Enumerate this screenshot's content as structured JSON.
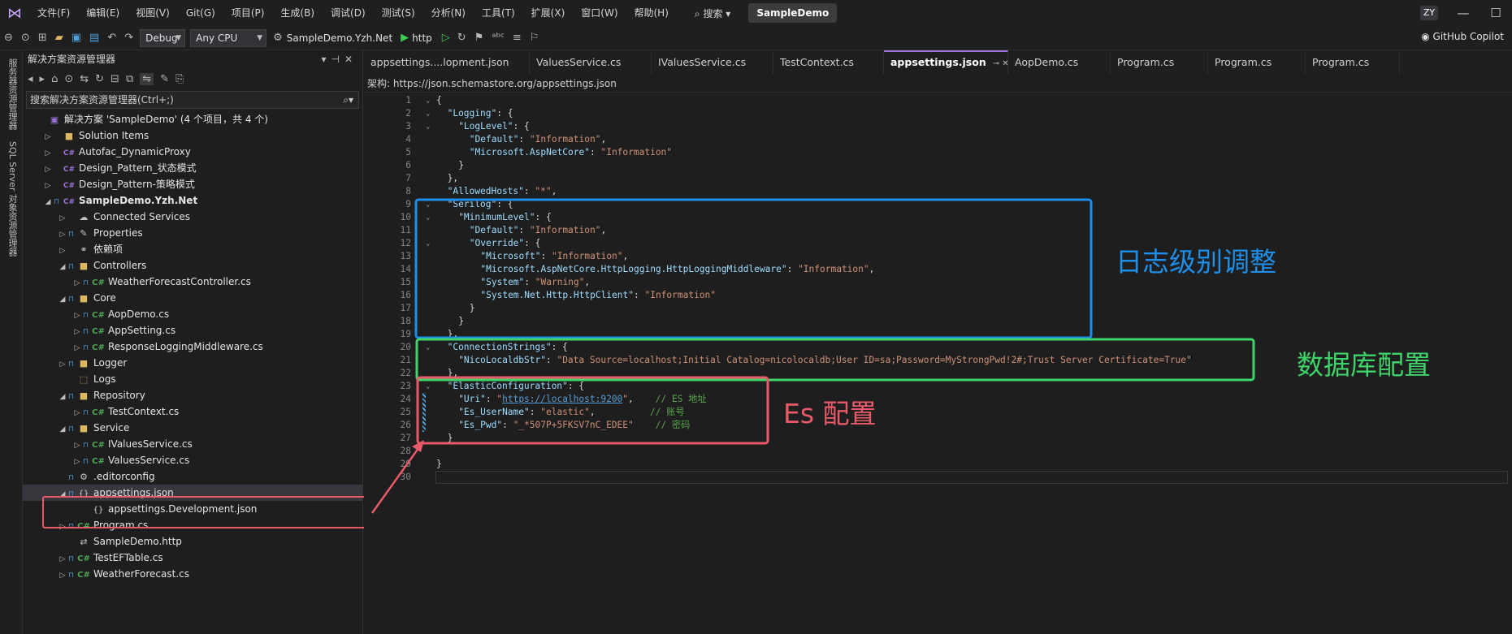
{
  "menubar": {
    "items": [
      "文件(F)",
      "编辑(E)",
      "视图(V)",
      "Git(G)",
      "项目(P)",
      "生成(B)",
      "调试(D)",
      "测试(S)",
      "分析(N)",
      "工具(T)",
      "扩展(X)",
      "窗口(W)",
      "帮助(H)"
    ],
    "search_label": "搜索",
    "project_name": "SampleDemo",
    "user_initials": "ZY"
  },
  "toolbar": {
    "config": "Debug",
    "platform": "Any CPU",
    "startup_project": "SampleDemo.Yzh.Net",
    "run_profile": "http",
    "copilot_label": "GitHub Copilot"
  },
  "left_strip": {
    "server_explorer": "服务器资源管理器",
    "sql_explorer": "SQL Server 对象资源管理器"
  },
  "solution_explorer": {
    "title": "解决方案资源管理器",
    "search_placeholder": "搜索解决方案资源管理器(Ctrl+;)",
    "tree": [
      {
        "label": "解决方案 'SampleDemo' (4 个项目，共 4 个)",
        "indent": 0,
        "icon": "solution-icon",
        "glyph": "▣",
        "expander": "",
        "lock": false
      },
      {
        "label": "Solution Items",
        "indent": 1,
        "icon": "folder-icon",
        "glyph": "■",
        "expander": "▷",
        "lock": false
      },
      {
        "label": "Autofac_DynamicProxy",
        "indent": 1,
        "icon": "csproj-icon",
        "glyph": "C#",
        "expander": "▷",
        "lock": false
      },
      {
        "label": "Design_Pattern_状态模式",
        "indent": 1,
        "icon": "csproj-icon",
        "glyph": "C#",
        "expander": "▷",
        "lock": false
      },
      {
        "label": "Design_Pattern-策略模式",
        "indent": 1,
        "icon": "csproj-icon",
        "glyph": "C#",
        "expander": "▷",
        "lock": false
      },
      {
        "label": "SampleDemo.Yzh.Net",
        "indent": 1,
        "icon": "csproj-icon",
        "glyph": "C#",
        "expander": "◢",
        "lock": true,
        "bold": true
      },
      {
        "label": "Connected Services",
        "indent": 2,
        "icon": "connected-services-icon",
        "glyph": "☁",
        "expander": "▷",
        "lock": false
      },
      {
        "label": "Properties",
        "indent": 2,
        "icon": "properties-icon",
        "glyph": "✎",
        "expander": "▷",
        "lock": true
      },
      {
        "label": "依赖项",
        "indent": 2,
        "icon": "dependencies-icon",
        "glyph": "⚭",
        "expander": "▷",
        "lock": false
      },
      {
        "label": "Controllers",
        "indent": 2,
        "icon": "folder-icon",
        "glyph": "■",
        "expander": "◢",
        "lock": true
      },
      {
        "label": "WeatherForecastController.cs",
        "indent": 3,
        "icon": "cs-file-icon",
        "glyph": "C#",
        "expander": "▷",
        "lock": true
      },
      {
        "label": "Core",
        "indent": 2,
        "icon": "folder-icon",
        "glyph": "■",
        "expander": "◢",
        "lock": true
      },
      {
        "label": "AopDemo.cs",
        "indent": 3,
        "icon": "cs-file-icon",
        "glyph": "C#",
        "expander": "▷",
        "lock": true
      },
      {
        "label": "AppSetting.cs",
        "indent": 3,
        "icon": "cs-file-icon",
        "glyph": "C#",
        "expander": "▷",
        "lock": true
      },
      {
        "label": "ResponseLoggingMiddleware.cs",
        "indent": 3,
        "icon": "cs-file-icon",
        "glyph": "C#",
        "expander": "▷",
        "lock": true
      },
      {
        "label": "Logger",
        "indent": 2,
        "icon": "folder-icon",
        "glyph": "■",
        "expander": "▷",
        "lock": true
      },
      {
        "label": "Logs",
        "indent": 2,
        "icon": "folder-icon",
        "glyph": "⬚",
        "expander": "",
        "lock": false
      },
      {
        "label": "Repository",
        "indent": 2,
        "icon": "folder-icon",
        "glyph": "■",
        "expander": "◢",
        "lock": true
      },
      {
        "label": "TestContext.cs",
        "indent": 3,
        "icon": "cs-file-icon",
        "glyph": "C#",
        "expander": "▷",
        "lock": true
      },
      {
        "label": "Service",
        "indent": 2,
        "icon": "folder-icon",
        "glyph": "■",
        "expander": "◢",
        "lock": true
      },
      {
        "label": "IValuesService.cs",
        "indent": 3,
        "icon": "cs-file-icon",
        "glyph": "C#",
        "expander": "▷",
        "lock": true
      },
      {
        "label": "ValuesService.cs",
        "indent": 3,
        "icon": "cs-file-icon",
        "glyph": "C#",
        "expander": "▷",
        "lock": true
      },
      {
        "label": ".editorconfig",
        "indent": 2,
        "icon": "config-file-icon",
        "glyph": "⚙",
        "expander": "",
        "lock": true
      },
      {
        "label": "appsettings.json",
        "indent": 2,
        "icon": "json-file-icon",
        "glyph": "{}",
        "expander": "◢",
        "lock": true,
        "selected": true
      },
      {
        "label": "appsettings.Development.json",
        "indent": 3,
        "icon": "json-file-icon",
        "glyph": "{}",
        "expander": "",
        "lock": false
      },
      {
        "label": "Program.cs",
        "indent": 2,
        "icon": "cs-file-icon",
        "glyph": "C#",
        "expander": "▷",
        "lock": true
      },
      {
        "label": "SampleDemo.http",
        "indent": 2,
        "icon": "http-file-icon",
        "glyph": "⇄",
        "expander": "",
        "lock": false
      },
      {
        "label": "TestEFTable.cs",
        "indent": 2,
        "icon": "cs-file-icon",
        "glyph": "C#",
        "expander": "▷",
        "lock": true
      },
      {
        "label": "WeatherForecast.cs",
        "indent": 2,
        "icon": "cs-file-icon",
        "glyph": "C#",
        "expander": "▷",
        "lock": true
      }
    ]
  },
  "tabs": [
    {
      "label": "appsettings....lopment.json",
      "width": 204
    },
    {
      "label": "ValuesService.cs",
      "width": 150
    },
    {
      "label": "IValuesService.cs",
      "width": 150
    },
    {
      "label": "TestContext.cs",
      "width": 136
    },
    {
      "label": "appsettings.json",
      "width": 153,
      "active": true
    },
    {
      "label": "AopDemo.cs",
      "width": 126
    },
    {
      "label": "Program.cs",
      "width": 120
    },
    {
      "label": "Program.cs",
      "width": 120
    },
    {
      "label": "Program.cs",
      "width": 116
    }
  ],
  "schema_bar": {
    "label": "架构:",
    "url": "https://json.schemastore.org/appsettings.json"
  },
  "code_lines": [
    {
      "n": 1,
      "f": "⌄",
      "t": [
        [
          "p",
          "{"
        ]
      ],
      "i": 0
    },
    {
      "n": 2,
      "f": "⌄",
      "t": [
        [
          "k",
          "\"Logging\""
        ],
        [
          "p",
          ": {"
        ]
      ],
      "i": 1
    },
    {
      "n": 3,
      "f": "⌄",
      "t": [
        [
          "k",
          "\"LogLevel\""
        ],
        [
          "p",
          ": {"
        ]
      ],
      "i": 2
    },
    {
      "n": 4,
      "f": "",
      "t": [
        [
          "k",
          "\"Default\""
        ],
        [
          "p",
          ": "
        ],
        [
          "s",
          "\"Information\""
        ],
        [
          "p",
          ","
        ]
      ],
      "i": 3
    },
    {
      "n": 5,
      "f": "",
      "t": [
        [
          "k",
          "\"Microsoft.AspNetCore\""
        ],
        [
          "p",
          ": "
        ],
        [
          "s",
          "\"Information\""
        ]
      ],
      "i": 3
    },
    {
      "n": 6,
      "f": "",
      "t": [
        [
          "p",
          "}"
        ]
      ],
      "i": 2
    },
    {
      "n": 7,
      "f": "",
      "t": [
        [
          "p",
          "},"
        ]
      ],
      "i": 1
    },
    {
      "n": 8,
      "f": "",
      "t": [
        [
          "k",
          "\"AllowedHosts\""
        ],
        [
          "p",
          ": "
        ],
        [
          "s",
          "\"*\""
        ],
        [
          "p",
          ","
        ]
      ],
      "i": 1
    },
    {
      "n": 9,
      "f": "⌄",
      "t": [
        [
          "k",
          "\"Serilog\""
        ],
        [
          "p",
          ": {"
        ]
      ],
      "i": 1
    },
    {
      "n": 10,
      "f": "⌄",
      "t": [
        [
          "k",
          "\"MinimumLevel\""
        ],
        [
          "p",
          ": {"
        ]
      ],
      "i": 2
    },
    {
      "n": 11,
      "f": "",
      "t": [
        [
          "k",
          "\"Default\""
        ],
        [
          "p",
          ": "
        ],
        [
          "s",
          "\"Information\""
        ],
        [
          "p",
          ","
        ]
      ],
      "i": 3
    },
    {
      "n": 12,
      "f": "⌄",
      "t": [
        [
          "k",
          "\"Override\""
        ],
        [
          "p",
          ": {"
        ]
      ],
      "i": 3
    },
    {
      "n": 13,
      "f": "",
      "t": [
        [
          "k",
          "\"Microsoft\""
        ],
        [
          "p",
          ": "
        ],
        [
          "s",
          "\"Information\""
        ],
        [
          "p",
          ","
        ]
      ],
      "i": 4
    },
    {
      "n": 14,
      "f": "",
      "t": [
        [
          "k",
          "\"Microsoft.AspNetCore.HttpLogging.HttpLoggingMiddleware\""
        ],
        [
          "p",
          ": "
        ],
        [
          "s",
          "\"Information\""
        ],
        [
          "p",
          ","
        ]
      ],
      "i": 4
    },
    {
      "n": 15,
      "f": "",
      "t": [
        [
          "k",
          "\"System\""
        ],
        [
          "p",
          ": "
        ],
        [
          "s",
          "\"Warning\""
        ],
        [
          "p",
          ","
        ]
      ],
      "i": 4
    },
    {
      "n": 16,
      "f": "",
      "t": [
        [
          "k",
          "\"System.Net.Http.HttpClient\""
        ],
        [
          "p",
          ": "
        ],
        [
          "s",
          "\"Information\""
        ]
      ],
      "i": 4
    },
    {
      "n": 17,
      "f": "",
      "t": [
        [
          "p",
          "}"
        ]
      ],
      "i": 3
    },
    {
      "n": 18,
      "f": "",
      "t": [
        [
          "p",
          "}"
        ]
      ],
      "i": 2
    },
    {
      "n": 19,
      "f": "",
      "t": [
        [
          "p",
          "},"
        ]
      ],
      "i": 1
    },
    {
      "n": 20,
      "f": "⌄",
      "t": [
        [
          "k",
          "\"ConnectionStrings\""
        ],
        [
          "p",
          ": {"
        ]
      ],
      "i": 1
    },
    {
      "n": 21,
      "f": "",
      "t": [
        [
          "k",
          "\"NicoLocaldbStr\""
        ],
        [
          "p",
          ": "
        ],
        [
          "s",
          "\"Data Source=localhost;Initial Catalog=nicolocaldb;User ID=sa;Password=MyStrongPwd!2#;Trust Server Certificate=True\""
        ]
      ],
      "i": 2
    },
    {
      "n": 22,
      "f": "",
      "t": [
        [
          "p",
          "},"
        ]
      ],
      "i": 1
    },
    {
      "n": 23,
      "f": "⌄",
      "t": [
        [
          "k",
          "\"ElasticConfiguration\""
        ],
        [
          "p",
          ": {"
        ]
      ],
      "i": 1
    },
    {
      "n": 24,
      "f": "",
      "t": [
        [
          "k",
          "\"Uri\""
        ],
        [
          "p",
          ": "
        ],
        [
          "s",
          "\""
        ],
        [
          "u",
          "https://localhost:9200"
        ],
        [
          "s",
          "\""
        ],
        [
          "p",
          ",    "
        ],
        [
          "c",
          "// ES 地址"
        ]
      ],
      "i": 2
    },
    {
      "n": 25,
      "f": "",
      "t": [
        [
          "k",
          "\"Es_UserName\""
        ],
        [
          "p",
          ": "
        ],
        [
          "s",
          "\"elastic\""
        ],
        [
          "p",
          ",          "
        ],
        [
          "c",
          "// 账号"
        ]
      ],
      "i": 2
    },
    {
      "n": 26,
      "f": "",
      "t": [
        [
          "k",
          "\"Es_Pwd\""
        ],
        [
          "p",
          ": "
        ],
        [
          "s",
          "\"_*507P+5FKSV7nC_EDEE\""
        ],
        [
          "p",
          "    "
        ],
        [
          "c",
          "// 密码"
        ]
      ],
      "i": 2
    },
    {
      "n": 27,
      "f": "",
      "t": [
        [
          "p",
          "}"
        ]
      ],
      "i": 1
    },
    {
      "n": 28,
      "f": "",
      "t": [
        [
          "p",
          ""
        ]
      ],
      "i": 1
    },
    {
      "n": 29,
      "f": "",
      "t": [
        [
          "p",
          "}"
        ]
      ],
      "i": 0
    },
    {
      "n": 30,
      "f": "",
      "t": [
        [
          "p",
          ""
        ]
      ],
      "i": 0
    }
  ],
  "annotations": {
    "log_level_label": "日志级别调整",
    "db_config_label": "数据库配置",
    "es_config_label": "Es 配置"
  },
  "colors": {
    "accent": "#9b73d6",
    "log_box": "#1f8ee8",
    "db_box": "#3fd46a",
    "es_box": "#e85a6a"
  }
}
